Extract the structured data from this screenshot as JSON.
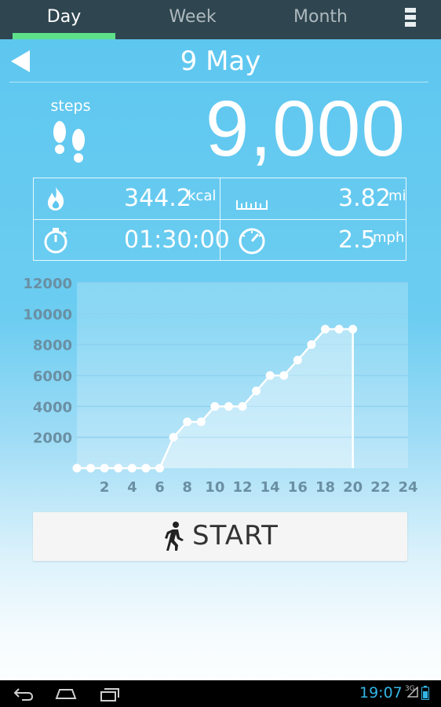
{
  "tabs": {
    "items": [
      {
        "label": "Day",
        "active": true
      },
      {
        "label": "Week",
        "active": false
      },
      {
        "label": "Month",
        "active": false
      }
    ],
    "menu_icon": "overflow-menu-icon"
  },
  "header": {
    "back_icon": "back-arrow-icon",
    "date": "9 May"
  },
  "steps": {
    "label": "steps",
    "value": "9,000",
    "icon": "footprints-icon"
  },
  "stats": {
    "calories": {
      "value": "344.2",
      "unit": "kcal",
      "icon": "flame-icon"
    },
    "distance": {
      "value": "3.82",
      "unit": "mi",
      "icon": "ruler-icon"
    },
    "duration": {
      "value": "01:30:00",
      "icon": "stopwatch-icon"
    },
    "speed": {
      "value": "2.5",
      "unit": "mph",
      "icon": "speedometer-icon"
    }
  },
  "chart_data": {
    "type": "area",
    "x": [
      0,
      1,
      2,
      3,
      4,
      5,
      6,
      7,
      8,
      9,
      10,
      11,
      12,
      13,
      14,
      15,
      16,
      17,
      18,
      19,
      20
    ],
    "values": [
      0,
      0,
      0,
      0,
      0,
      0,
      0,
      2000,
      3000,
      3000,
      4000,
      4000,
      4000,
      5000,
      6000,
      6000,
      7000,
      8000,
      9000,
      9000,
      9000
    ],
    "x_ticks": [
      "2",
      "4",
      "6",
      "8",
      "10",
      "12",
      "14",
      "16",
      "18",
      "20",
      "22",
      "24"
    ],
    "y_ticks": [
      "2000",
      "4000",
      "6000",
      "8000",
      "10000",
      "12000"
    ],
    "xlim": [
      0,
      24
    ],
    "ylim": [
      0,
      12000
    ],
    "grid": true,
    "colors": {
      "line": "#ffffff",
      "fill": "rgba(255,255,255,0.35)",
      "tick": "#6a8fa3",
      "plot_bg": "rgba(255,255,255,0.22)",
      "grid": "#8dd2ef"
    }
  },
  "start_button": {
    "label": "START",
    "icon": "walking-person-icon"
  },
  "navbar": {
    "back_icon": "nav-back-icon",
    "home_icon": "nav-home-icon",
    "recents_icon": "nav-recents-icon",
    "time": "19:07",
    "network": "3G"
  }
}
